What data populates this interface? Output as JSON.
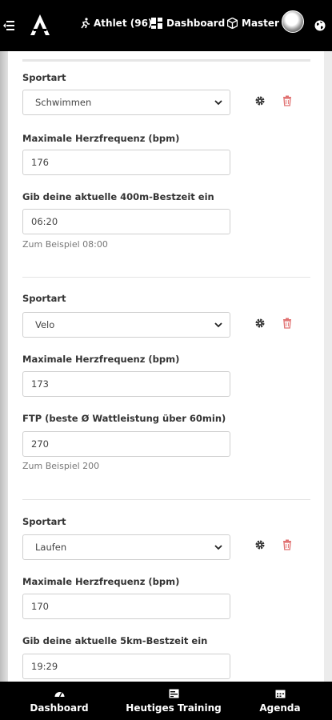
{
  "topbar": {
    "menu_icon": "menu-collapse-icon",
    "logo_icon": "brand-logo-icon",
    "athlete_label": "Athlet (96)",
    "dashboard_label": "Dashboard",
    "master_label": "Master",
    "globe_icon": "globe-icon"
  },
  "sports": [
    {
      "sport_label": "Sportart",
      "sport_value": "Schwimmen",
      "hr_label": "Maximale Herzfrequenz (bpm)",
      "hr_value": "176",
      "perf_label": "Gib deine aktuelle 400m-Bestzeit ein",
      "perf_value": "06:20",
      "perf_hint": "Zum Beispiel 08:00"
    },
    {
      "sport_label": "Sportart",
      "sport_value": "Velo",
      "hr_label": "Maximale Herzfrequenz (bpm)",
      "hr_value": "173",
      "perf_label": "FTP (beste Ø Wattleistung über 60min)",
      "perf_value": "270",
      "perf_hint": "Zum Beispiel 200"
    },
    {
      "sport_label": "Sportart",
      "sport_value": "Laufen",
      "hr_label": "Maximale Herzfrequenz (bpm)",
      "hr_value": "170",
      "perf_label": "Gib deine aktuelle 5km-Bestzeit ein",
      "perf_value": "19:29"
    }
  ],
  "bottomnav": {
    "dashboard_label": "Dashboard",
    "training_label": "Heutiges Training",
    "agenda_label": "Agenda"
  },
  "colors": {
    "delete_icon": "#e07070",
    "settings_icon": "#333333",
    "bar_background": "#000000"
  }
}
